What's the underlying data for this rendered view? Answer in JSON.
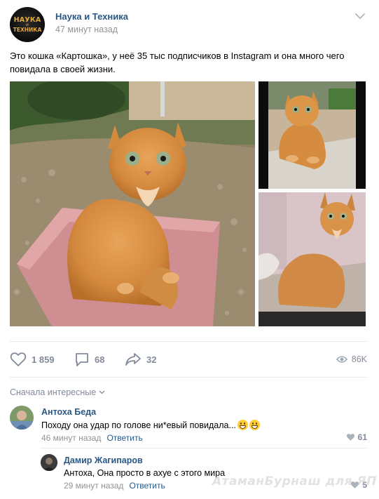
{
  "post": {
    "group_name": "Наука и Техника",
    "time": "47 минут назад",
    "text": "Это кошка «Картошка», у неё 35 тыс подписчиков в Instagram и она много чего повидала в своей жизни.",
    "avatar": {
      "line1": "НАУКА",
      "line2": "и",
      "line3": "ТЕХНИКА"
    }
  },
  "actions": {
    "likes": "1 859",
    "comments": "68",
    "shares": "32",
    "views": "86K"
  },
  "comments_section": {
    "sort_label": "Сначала интересные",
    "comments": [
      {
        "author": "Антоха Беда",
        "text": "Походу она удар по голове ни*евый повидала...",
        "time": "46 минут назад",
        "reply_label": "Ответить",
        "likes": "61"
      },
      {
        "author": "Дамир Жагипаров",
        "text": "Антоха, Она просто в ахуе с этого мира",
        "time": "29 минут назад",
        "reply_label": "Ответить",
        "likes": "5"
      }
    ]
  },
  "watermark": "АтаманБурнаш для ЯП",
  "colors": {
    "link": "#2a5885",
    "muted": "#828a99",
    "divider": "#e7e8ec"
  }
}
